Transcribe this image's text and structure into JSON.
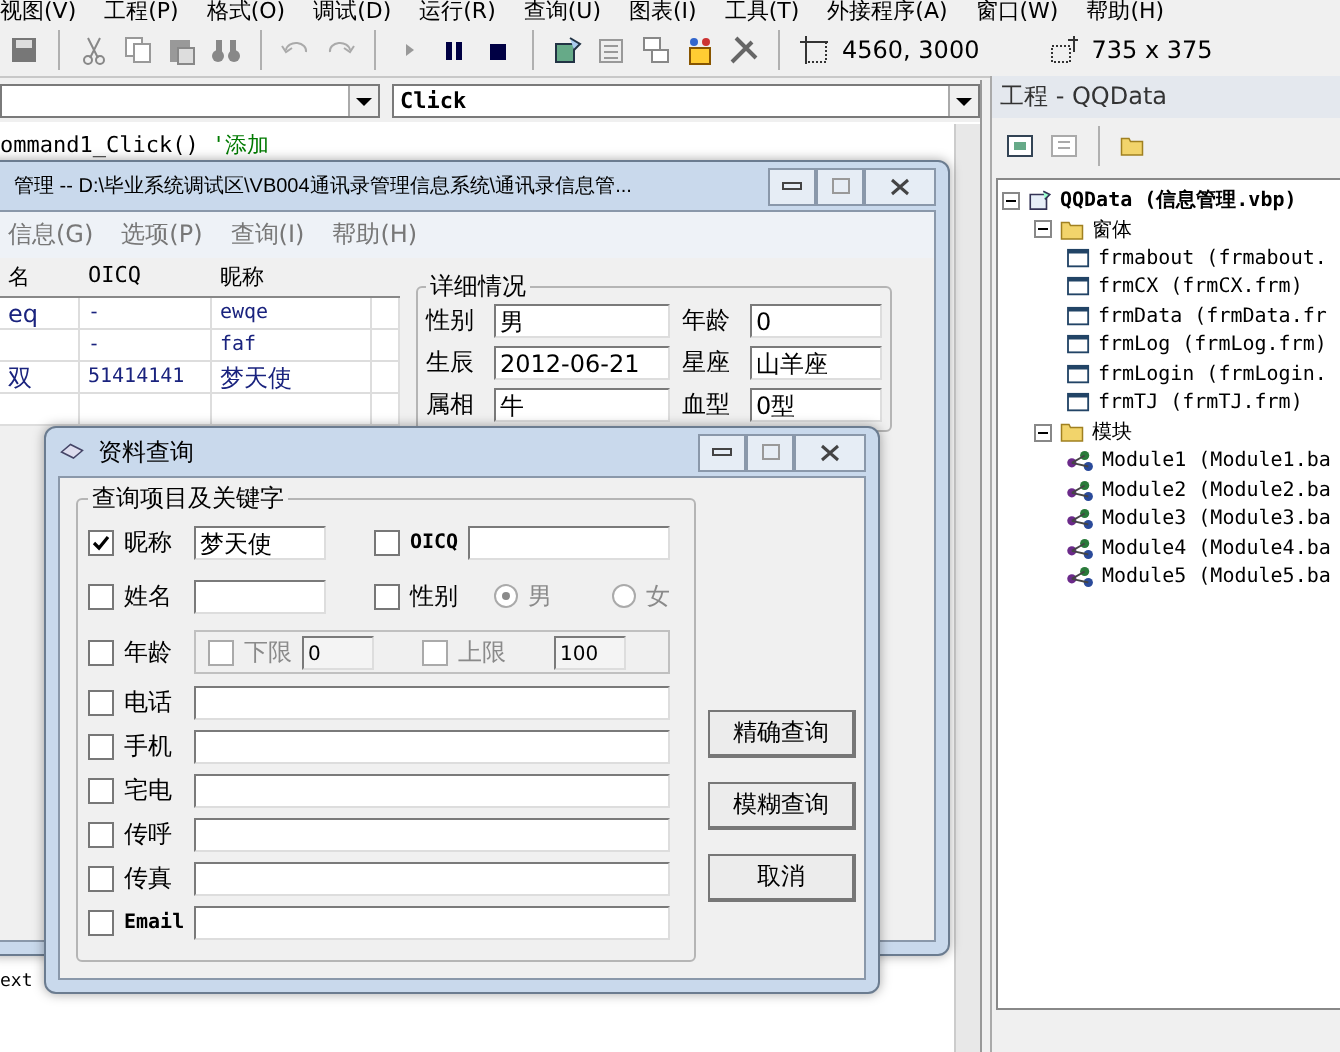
{
  "ide_menu": [
    "视图(V)",
    "工程(P)",
    "格式(O)",
    "调试(D)",
    "运行(R)",
    "查询(U)",
    "图表(I)",
    "工具(T)",
    "外接程序(A)",
    "窗口(W)",
    "帮助(H)"
  ],
  "toolbar": {
    "position": "4560, 3000",
    "size": "735 x 375"
  },
  "code_window": {
    "procedure_combo": "Click",
    "code_text": "ommand1_Click() ",
    "comment": "'添加",
    "bottom_text": "ext"
  },
  "project_panel": {
    "title": "工程 - QQData",
    "tree": [
      {
        "label": "QQData (信息管理.vbp)",
        "kind": "project",
        "expanded": true,
        "children": [
          {
            "label": "窗体",
            "kind": "folder",
            "expanded": true,
            "children": [
              {
                "label": "frmabout (frmabout.",
                "kind": "form"
              },
              {
                "label": "frmCX (frmCX.frm)",
                "kind": "form"
              },
              {
                "label": "frmData (frmData.fr",
                "kind": "form"
              },
              {
                "label": "frmLog (frmLog.frm)",
                "kind": "form"
              },
              {
                "label": "frmLogin (frmLogin.",
                "kind": "form"
              },
              {
                "label": "frmTJ (frmTJ.frm)",
                "kind": "form"
              }
            ]
          },
          {
            "label": "模块",
            "kind": "folder",
            "expanded": true,
            "children": [
              {
                "label": "Module1 (Module1.ba",
                "kind": "module"
              },
              {
                "label": "Module2 (Module2.ba",
                "kind": "module"
              },
              {
                "label": "Module3 (Module3.ba",
                "kind": "module"
              },
              {
                "label": "Module4 (Module4.ba",
                "kind": "module"
              },
              {
                "label": "Module5 (Module5.ba",
                "kind": "module"
              }
            ]
          }
        ]
      }
    ]
  },
  "main_form": {
    "title": "管理 -- D:\\毕业系统调试区\\VB004通讯录管理信息系统\\通讯录信息管...",
    "menu": [
      "信息(G)",
      "选项(P)",
      "查询(I)",
      "帮助(H)"
    ],
    "columns": [
      "名",
      "OICQ",
      "昵称"
    ],
    "rows": [
      [
        "eq",
        "-",
        "ewqe"
      ],
      [
        "",
        "-",
        "faf"
      ],
      [
        "双",
        "51414141",
        "梦天使"
      ]
    ],
    "detail_title": "详细情况",
    "details": [
      {
        "label": "性别",
        "value": "男"
      },
      {
        "label": "年龄",
        "value": "0"
      },
      {
        "label": "生辰",
        "value": "2012-06-21"
      },
      {
        "label": "星座",
        "value": "山羊座"
      },
      {
        "label": "属相",
        "value": "牛"
      },
      {
        "label": "血型",
        "value": "0型"
      }
    ]
  },
  "query_dialog": {
    "title": "资料查询",
    "group_title": "查询项目及关键字",
    "rows": [
      {
        "kind": "pair",
        "items": [
          {
            "label": "昵称",
            "checked": true,
            "value": "梦天使"
          },
          {
            "label": "OICQ",
            "checked": false,
            "value": ""
          }
        ]
      },
      {
        "kind": "gender",
        "items": [
          {
            "label": "姓名",
            "checked": false,
            "value": ""
          },
          {
            "label": "性别",
            "checked": false
          }
        ],
        "options": [
          {
            "label": "男",
            "selected": true
          },
          {
            "label": "女",
            "selected": false
          }
        ]
      },
      {
        "kind": "range",
        "label": "年龄",
        "checked": false,
        "low": {
          "label": "下限",
          "checked": false,
          "value": "0"
        },
        "high": {
          "label": "上限",
          "checked": false,
          "value": "100"
        }
      },
      {
        "kind": "text",
        "label": "电话",
        "checked": false,
        "value": ""
      },
      {
        "kind": "text",
        "label": "手机",
        "checked": false,
        "value": ""
      },
      {
        "kind": "text",
        "label": "宅电",
        "checked": false,
        "value": ""
      },
      {
        "kind": "text",
        "label": "传呼",
        "checked": false,
        "value": ""
      },
      {
        "kind": "text",
        "label": "传真",
        "checked": false,
        "value": ""
      },
      {
        "kind": "text",
        "label": "Email",
        "checked": false,
        "value": ""
      }
    ],
    "buttons": [
      "精确查询",
      "模糊查询",
      "取消"
    ]
  }
}
